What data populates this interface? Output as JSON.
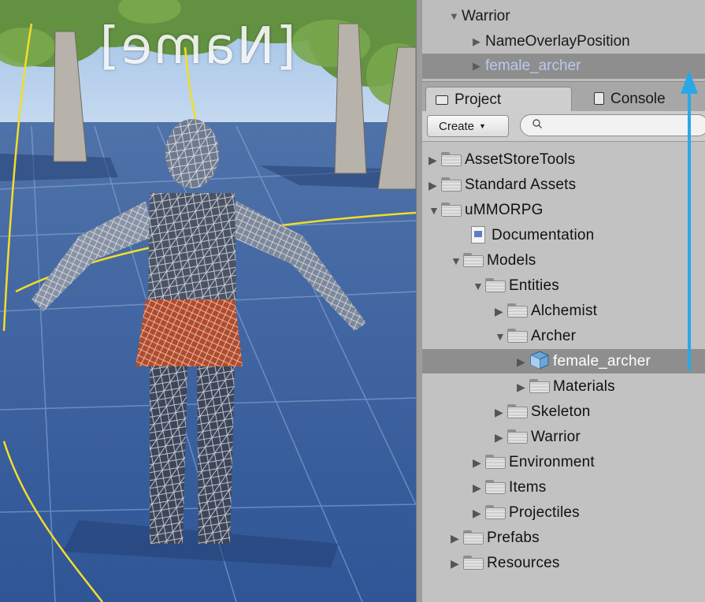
{
  "scene": {
    "name_overlay": "[Name]"
  },
  "hierarchy": {
    "items": [
      {
        "label": "Warrior",
        "expanded": true
      },
      {
        "label": "NameOverlayPosition",
        "expanded": false
      },
      {
        "label": "female_archer",
        "expanded": false,
        "selected": true
      }
    ]
  },
  "tabs": {
    "project": "Project",
    "console": "Console"
  },
  "toolbar": {
    "create_label": "Create",
    "search_placeholder": ""
  },
  "tree": {
    "items": [
      {
        "label": "AssetStoreTools",
        "icon": "folder-icon",
        "expanded": false
      },
      {
        "label": "Standard Assets",
        "icon": "folder-icon",
        "expanded": false
      },
      {
        "label": "uMMORPG",
        "icon": "folder-icon",
        "expanded": true
      },
      {
        "label": "Documentation",
        "icon": "document-icon"
      },
      {
        "label": "Models",
        "icon": "folder-icon",
        "expanded": true
      },
      {
        "label": "Entities",
        "icon": "folder-icon",
        "expanded": true
      },
      {
        "label": "Alchemist",
        "icon": "folder-icon",
        "expanded": false
      },
      {
        "label": "Archer",
        "icon": "folder-icon",
        "expanded": true
      },
      {
        "label": "female_archer",
        "icon": "model-cube-icon",
        "expanded": false,
        "selected": true
      },
      {
        "label": "Materials",
        "icon": "folder-icon",
        "expanded": false
      },
      {
        "label": "Skeleton",
        "icon": "folder-icon",
        "expanded": false
      },
      {
        "label": "Warrior",
        "icon": "folder-icon",
        "expanded": false
      },
      {
        "label": "Environment",
        "icon": "folder-icon",
        "expanded": false
      },
      {
        "label": "Items",
        "icon": "folder-icon",
        "expanded": false
      },
      {
        "label": "Projectiles",
        "icon": "folder-icon",
        "expanded": false
      },
      {
        "label": "Prefabs",
        "icon": "folder-icon",
        "expanded": false
      },
      {
        "label": "Resources",
        "icon": "folder-icon",
        "expanded": false
      }
    ]
  },
  "colors": {
    "selection": "#8e8e8e",
    "selected_text_hierarchy": "#b9c9ef",
    "annotation_arrow": "#29a8e8",
    "ground": "#3e5f98"
  }
}
